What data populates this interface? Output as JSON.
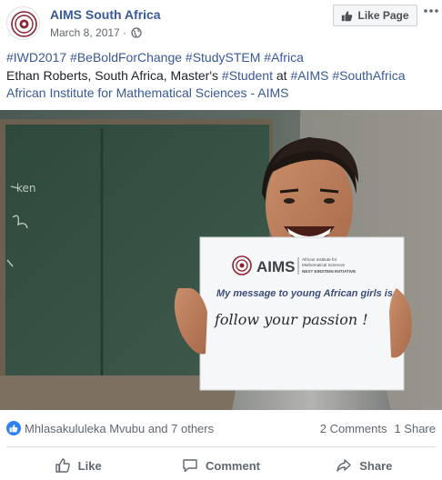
{
  "header": {
    "page_name": "AIMS South Africa",
    "date": "March 8, 2017",
    "separator": "·",
    "like_page_label": "Like Page",
    "more_label": "•••"
  },
  "post": {
    "line1": [
      {
        "text": "#IWD2017",
        "link": true
      },
      {
        "text": " ",
        "link": false
      },
      {
        "text": "#BeBoldForChange",
        "link": true
      },
      {
        "text": " ",
        "link": false
      },
      {
        "text": "#StudySTEM",
        "link": true
      },
      {
        "text": " ",
        "link": false
      },
      {
        "text": "#Africa",
        "link": true
      }
    ],
    "line2": [
      {
        "text": "Ethan Roberts, South Africa, Master's ",
        "link": false
      },
      {
        "text": "#Student",
        "link": true
      },
      {
        "text": " at ",
        "link": false
      },
      {
        "text": "#AIMS",
        "link": true
      },
      {
        "text": " ",
        "link": false
      },
      {
        "text": "#SouthAfrica",
        "link": true
      }
    ],
    "line3": [
      {
        "text": "African Institute for Mathematical Sciences - AIMS",
        "link": true
      }
    ]
  },
  "photo": {
    "sign_logo": "AIMS",
    "sign_logo_sub1": "African Institute for",
    "sign_logo_sub2": "Mathematical Sciences",
    "sign_logo_sub3": "NEXT EINSTEIN INITIATIVE",
    "sign_message": "My message to young African girls is...",
    "sign_handwriting": "follow your passion !",
    "board_scribble": "ken"
  },
  "engagement": {
    "reactors": "Mhlasakululeka Mvubu and 7 others",
    "comments": "2 Comments",
    "shares": "1 Share"
  },
  "actions": {
    "like": "Like",
    "comment": "Comment",
    "share": "Share"
  },
  "colors": {
    "link": "#385898",
    "text": "#1d2129",
    "muted": "#606770",
    "like_blue": "#2e80f4",
    "aims_red": "#8b2532"
  }
}
